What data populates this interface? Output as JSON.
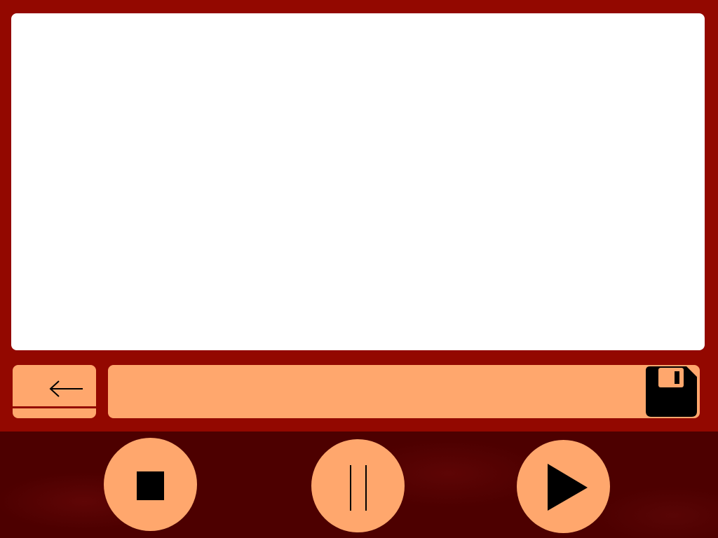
{
  "colors": {
    "frame": "#930800",
    "accent": "#ffa76d",
    "display": "#ffffff",
    "controls_bg": "#4d0000",
    "icon": "#000000"
  },
  "display": {
    "content": ""
  },
  "toolbar": {
    "back_icon": "left-arrow-icon",
    "filename_value": "",
    "save_icon": "floppy-disk-icon"
  },
  "controls": {
    "stop_icon": "stop-icon",
    "pause_icon": "pause-icon",
    "play_icon": "play-icon"
  }
}
